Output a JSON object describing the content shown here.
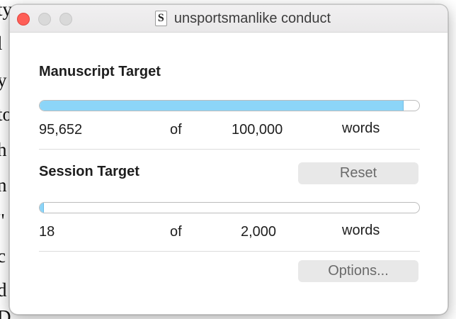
{
  "background_document": {
    "lines": [
      "ty",
      "l",
      "y",
      "to",
      "h",
      "n",
      "\"",
      "c",
      "d",
      "D"
    ]
  },
  "window": {
    "title": "unsportsmanlike conduct",
    "doc_icon_letter": "S"
  },
  "manuscript": {
    "heading": "Manuscript Target",
    "current": "95,652",
    "of_label": "of",
    "target": "100,000",
    "unit": "words",
    "progress_fraction": 0.9565
  },
  "session": {
    "heading": "Session Target",
    "reset_label": "Reset",
    "current": "18",
    "of_label": "of",
    "target": "2,000",
    "unit": "words",
    "progress_fraction": 0.009
  },
  "options_label": "Options...",
  "colors": {
    "progress_fill": "#8cd5f8",
    "close_button": "#fe5f57"
  }
}
